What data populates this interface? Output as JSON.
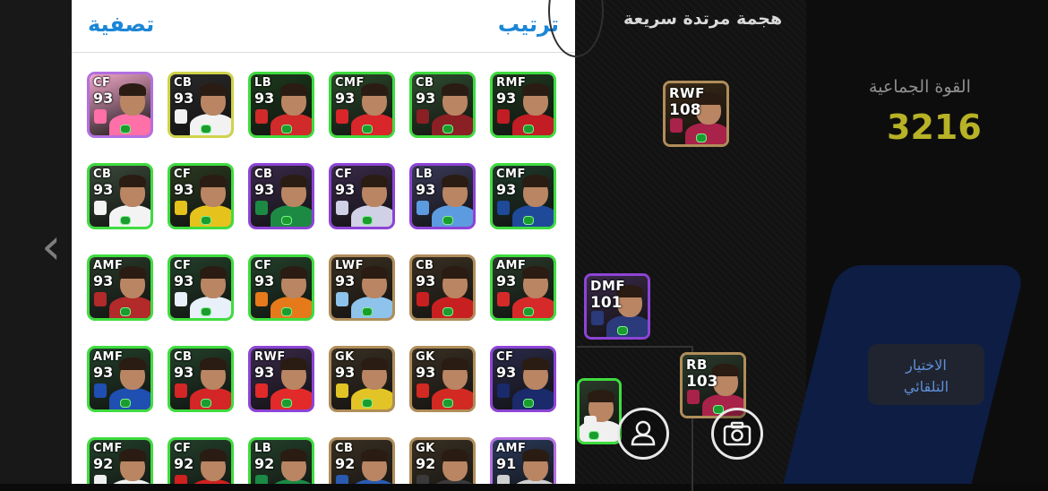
{
  "panel": {
    "filter_label": "تصفية",
    "sort_label": "ترتيب"
  },
  "cards": [
    {
      "pos": "CF",
      "ovr": "93",
      "bg": "#f1a7c8",
      "shirt": "#ff6fa8",
      "border": "b-pink"
    },
    {
      "pos": "CB",
      "ovr": "93",
      "bg": "#2a2a2a",
      "shirt": "#f2f2f2",
      "border": "b-light"
    },
    {
      "pos": "LB",
      "ovr": "93",
      "bg": "#1c3a1c",
      "shirt": "#d02a2a",
      "border": ""
    },
    {
      "pos": "CMF",
      "ovr": "93",
      "bg": "#2a4a2a",
      "shirt": "#d8262a",
      "border": ""
    },
    {
      "pos": "CB",
      "ovr": "93",
      "bg": "#2f4d2f",
      "shirt": "#8a1f24",
      "border": ""
    },
    {
      "pos": "RMF",
      "ovr": "93",
      "bg": "#1f3a1f",
      "shirt": "#c21c24",
      "border": ""
    },
    {
      "pos": "CB",
      "ovr": "93",
      "bg": "#3a4a3a",
      "shirt": "#f3f3f3",
      "border": ""
    },
    {
      "pos": "CF",
      "ovr": "93",
      "bg": "#2b3a20",
      "shirt": "#e6c21d",
      "border": ""
    },
    {
      "pos": "CB",
      "ovr": "93",
      "bg": "#3a2a4a",
      "shirt": "#1d8a44",
      "border": "b-purple"
    },
    {
      "pos": "CF",
      "ovr": "93",
      "bg": "#3a2a4a",
      "shirt": "#d0d0e6",
      "border": "b-purple"
    },
    {
      "pos": "LB",
      "ovr": "93",
      "bg": "#3a3a5a",
      "shirt": "#5d9be0",
      "border": "b-purple"
    },
    {
      "pos": "CMF",
      "ovr": "93",
      "bg": "#1f3a2a",
      "shirt": "#1f4a9a",
      "border": ""
    },
    {
      "pos": "AMF",
      "ovr": "93",
      "bg": "#2a3a2a",
      "shirt": "#b22a2a",
      "border": ""
    },
    {
      "pos": "CF",
      "ovr": "93",
      "bg": "#23402a",
      "shirt": "#e8f0fa",
      "border": ""
    },
    {
      "pos": "CF",
      "ovr": "93",
      "bg": "#23402a",
      "shirt": "#e67a1a",
      "border": ""
    },
    {
      "pos": "LWF",
      "ovr": "93",
      "bg": "#3a3022",
      "shirt": "#8ec3ec",
      "border": "b-gold"
    },
    {
      "pos": "CB",
      "ovr": "93",
      "bg": "#3a3022",
      "shirt": "#c82020",
      "border": "b-gold"
    },
    {
      "pos": "AMF",
      "ovr": "93",
      "bg": "#2a3a2a",
      "shirt": "#d62a2a",
      "border": ""
    },
    {
      "pos": "AMF",
      "ovr": "93",
      "bg": "#23402a",
      "shirt": "#1f4fb0",
      "border": ""
    },
    {
      "pos": "CB",
      "ovr": "93",
      "bg": "#23402a",
      "shirt": "#d42626",
      "border": ""
    },
    {
      "pos": "RWF",
      "ovr": "93",
      "bg": "#3a2a4a",
      "shirt": "#e22a2a",
      "border": "b-purple"
    },
    {
      "pos": "GK",
      "ovr": "93",
      "bg": "#3a3022",
      "shirt": "#e2c426",
      "border": "b-gold"
    },
    {
      "pos": "GK",
      "ovr": "93",
      "bg": "#3a3022",
      "shirt": "#d22a22",
      "border": "b-gold"
    },
    {
      "pos": "CF",
      "ovr": "93",
      "bg": "#2a2a4a",
      "shirt": "#1a2a6a",
      "border": "b-purple"
    },
    {
      "pos": "CMF",
      "ovr": "92",
      "bg": "#23402a",
      "shirt": "#f0f0f0",
      "border": ""
    },
    {
      "pos": "CF",
      "ovr": "92",
      "bg": "#23402a",
      "shirt": "#d02020",
      "border": ""
    },
    {
      "pos": "LB",
      "ovr": "92",
      "bg": "#23402a",
      "shirt": "#1a8a44",
      "border": ""
    },
    {
      "pos": "CB",
      "ovr": "92",
      "bg": "#3a3022",
      "shirt": "#2a5ab0",
      "border": "b-gold"
    },
    {
      "pos": "GK",
      "ovr": "92",
      "bg": "#3a3022",
      "shirt": "#3a3a3a",
      "border": "b-gold"
    },
    {
      "pos": "AMF",
      "ovr": "91",
      "bg": "#2a3a5a",
      "shirt": "#d0d0d0",
      "border": "b-pink"
    }
  ],
  "squad": {
    "formation_name": "هجمة مرتدة سريعة",
    "team_strength_label": "القوة الجماعية",
    "team_strength_value": "3216",
    "auto_select_line1": "الاختيار",
    "auto_select_line2": "التلقائي",
    "players": [
      {
        "pos": "RWF",
        "ovr": "108",
        "bg": "#3a2a16",
        "shirt": "#a8224a"
      },
      {
        "pos": "DMF",
        "ovr": "101",
        "bg": "#3a2a4a",
        "shirt": "#2a3a7a"
      },
      {
        "pos": "RB",
        "ovr": "103",
        "bg": "#2a3a2a",
        "shirt": "#a8224a"
      },
      {
        "pos": "",
        "ovr": "",
        "bg": "#2a3a2a",
        "shirt": "#f0f0f0"
      }
    ]
  }
}
